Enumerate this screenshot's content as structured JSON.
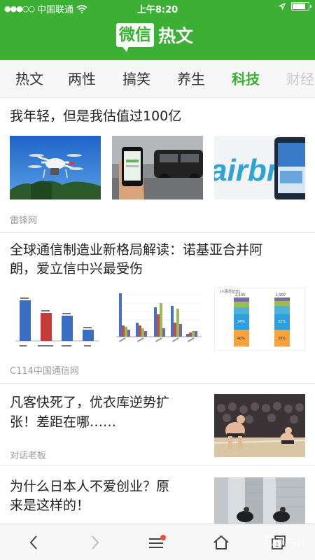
{
  "status_bar": {
    "carrier": "中国联通",
    "time": "上午8:20"
  },
  "header": {
    "logo_box_text": "微信",
    "logo_text": "热文",
    "brand_color": "#3cb034"
  },
  "tabs": [
    {
      "label": "热文"
    },
    {
      "label": "两性"
    },
    {
      "label": "搞笑"
    },
    {
      "label": "养生"
    },
    {
      "label": "科技"
    },
    {
      "label": "财经"
    }
  ],
  "active_tab": "科技",
  "articles": [
    {
      "title": "我年轻，但是我估值过100亿",
      "source": "雷锋网",
      "images": [
        "drone-photo",
        "taxi-app-photo",
        "airbnb-app-photo"
      ]
    },
    {
      "title_line1": "全球通信制造业新格局解读：诺基亚合并阿",
      "title_line2": "朗，爱立信中兴最受伤",
      "source": "C114中国通信网",
      "images": [
        "bar-chart-image",
        "grouped-bar-chart-image",
        "stacked-bar-chart-image"
      ],
      "chart_thumb_labels": {
        "stacked_header": "(人民币亿元)",
        "stacked_values": [
          "2,135",
          "1,997"
        ],
        "segments": [
          "34%",
          "32%",
          "40%",
          "39%"
        ]
      }
    },
    {
      "title_line1": "凡客快死了，优衣库逆势扩",
      "title_line2": "张！差距在哪……",
      "source": "对话老板",
      "images": [
        "sumo-photo"
      ]
    },
    {
      "title_line1": "为什么日本人不爱创业？原",
      "title_line2": "来是这样的！",
      "images": [
        "business-people-photo"
      ]
    }
  ],
  "bottom_bar": {
    "watermark": "Dorsn"
  }
}
